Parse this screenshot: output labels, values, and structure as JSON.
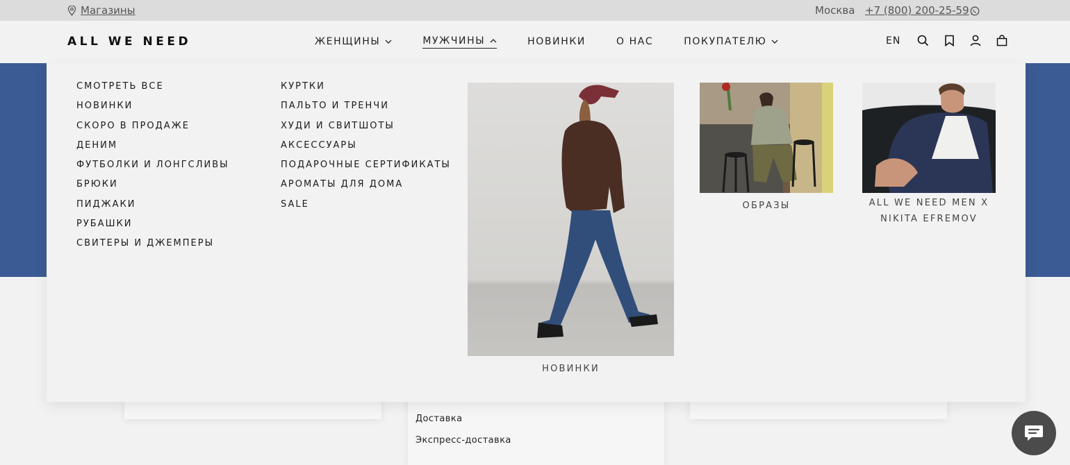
{
  "topbar": {
    "stores_label": "Магазины",
    "city": "Москва",
    "phone": "+7 (800) 200-25-59"
  },
  "header": {
    "logo": "ALL WE NEED",
    "nav": [
      {
        "label": "ЖЕНЩИНЫ",
        "chevron": "down"
      },
      {
        "label": "МУЖЧИНЫ",
        "chevron": "up",
        "active": true
      },
      {
        "label": "НОВИНКИ"
      },
      {
        "label": "О НАС"
      },
      {
        "label": "ПОКУПАТЕЛЮ",
        "chevron": "down"
      }
    ],
    "lang": "EN",
    "icons": [
      "search-icon",
      "bookmark-icon",
      "user-icon",
      "bag-icon"
    ]
  },
  "menu": {
    "col1": [
      "СМОТРЕТЬ ВСЕ",
      "НОВИНКИ",
      "СКОРО В ПРОДАЖЕ",
      "ДЕНИМ",
      "ФУТБОЛКИ И ЛОНГСЛИВЫ",
      "БРЮКИ",
      "ПИДЖАКИ",
      "РУБАШКИ",
      "СВИТЕРЫ И ДЖЕМПЕРЫ"
    ],
    "col2": [
      "КУРТКИ",
      "ПАЛЬТО И ТРЕНЧИ",
      "ХУДИ И СВИТШОТЫ",
      "АКСЕССУАРЫ",
      "ПОДАРОЧНЫЕ СЕРТИФИКАТЫ",
      "АРОМАТЫ ДЛЯ ДОМА",
      "SALE"
    ],
    "promos": [
      {
        "caption": "НОВИНКИ"
      },
      {
        "caption": "ОБРАЗЫ"
      },
      {
        "caption_line1": "ALL WE NEED MEN X",
        "caption_line2": "NIKITA EFREMOV"
      }
    ]
  },
  "background": {
    "links": [
      "Доставка",
      "Экспресс-доставка"
    ]
  },
  "colors": {
    "hero_blue": "#3b5b94",
    "topbar": "#dcdcdc",
    "menu_bg": "#f2f2f2",
    "chat_button": "#4b4b4b"
  }
}
